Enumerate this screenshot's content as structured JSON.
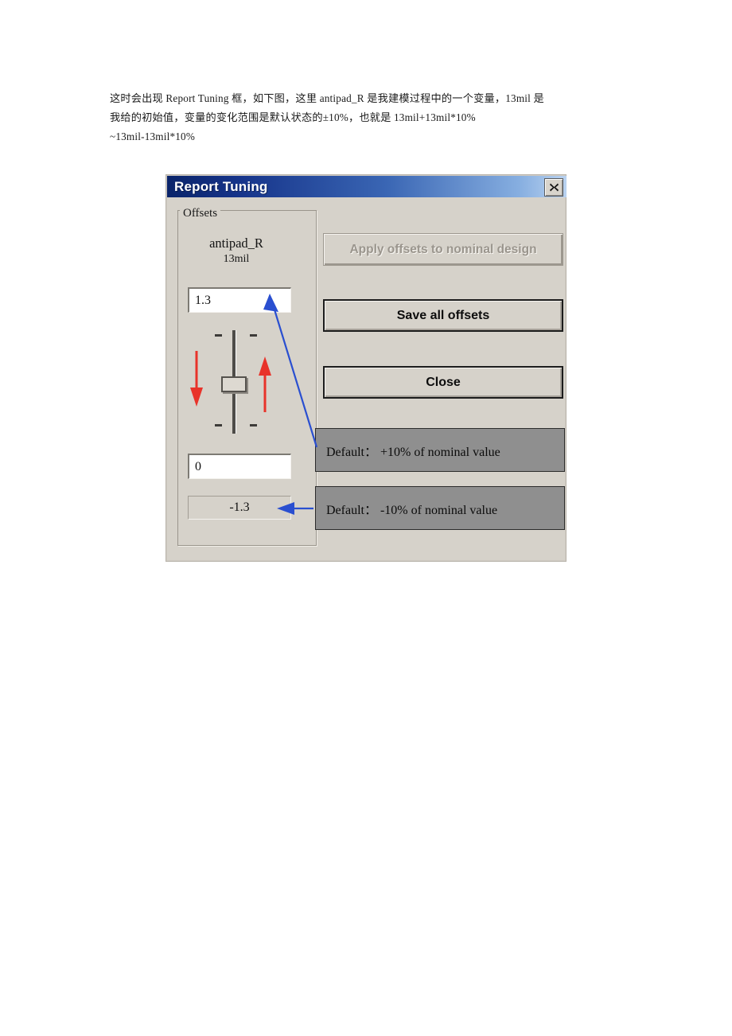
{
  "document": {
    "lines": [
      "这时会出现 Report Tuning 框，如下图，这里 antipad_R 是我建模过程中的一个变量，13mil 是",
      "我给的初始值，变量的变化范围是默认状态的±10%，也就是 13mil+13mil*10%",
      "~13mil-13mil*10%"
    ]
  },
  "dialog": {
    "title": "Report Tuning",
    "close_icon": "close-x-icon",
    "offsets": {
      "legend": "Offsets",
      "variable_name": "antipad_R",
      "nominal_value": "13mil",
      "upper_field_value": "1.3",
      "mid_field_value": "0",
      "lower_field_value": "-1.3",
      "slider": {
        "name": "offset-slider",
        "orientation": "vertical",
        "position": "middle"
      }
    },
    "buttons": {
      "apply": "Apply offsets to nominal design",
      "apply_enabled": false,
      "save": "Save all offsets",
      "save_enabled": true,
      "close": "Close",
      "close_enabled": true
    }
  },
  "annotations": {
    "callout_plus": "Default：  +10% of nominal value",
    "callout_minus": "Default：  -10% of nominal value",
    "red_arrow_down": "red-down-arrow",
    "red_arrow_up": "red-up-arrow",
    "blue_arrow_to_upper_field": "blue-arrow-upper",
    "blue_arrow_to_lower_field": "blue-arrow-lower"
  },
  "colors": {
    "titlebar_start": "#0a246a",
    "titlebar_end": "#b9d2f0",
    "dialog_face": "#d6d2ca",
    "callout_fill": "#8f8f8f",
    "red_arrow": "#e8332a",
    "blue_arrow": "#2a4fd0"
  }
}
